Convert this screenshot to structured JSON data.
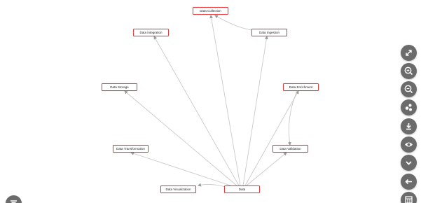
{
  "graph": {
    "nodes": {
      "data_collection": "Data Collection",
      "data_integration": "Data Integration",
      "data_ingestion": "Data Ingestion",
      "data_storage": "Data Storage",
      "data_enrichment": "Data Enrichment",
      "data_transformation": "Data Transformation",
      "data_validation": "Data Validation",
      "data_visualization": "Data Visualization",
      "data": "Data"
    },
    "colors": {
      "node_border": "#e8393c",
      "edge": "#c9c9c9",
      "arrow": "#9a9a9a",
      "control_button": "#6b6b6b",
      "control_icon": "#ffffff"
    }
  },
  "toolbar": {
    "icons": [
      "fullscreen-icon",
      "zoom-in-icon",
      "zoom-out-icon",
      "layout-icon",
      "download-icon",
      "eye-icon",
      "chevron-down-icon",
      "arrow-left-icon",
      "table-icon"
    ],
    "menu_icon": "menu-icon"
  }
}
